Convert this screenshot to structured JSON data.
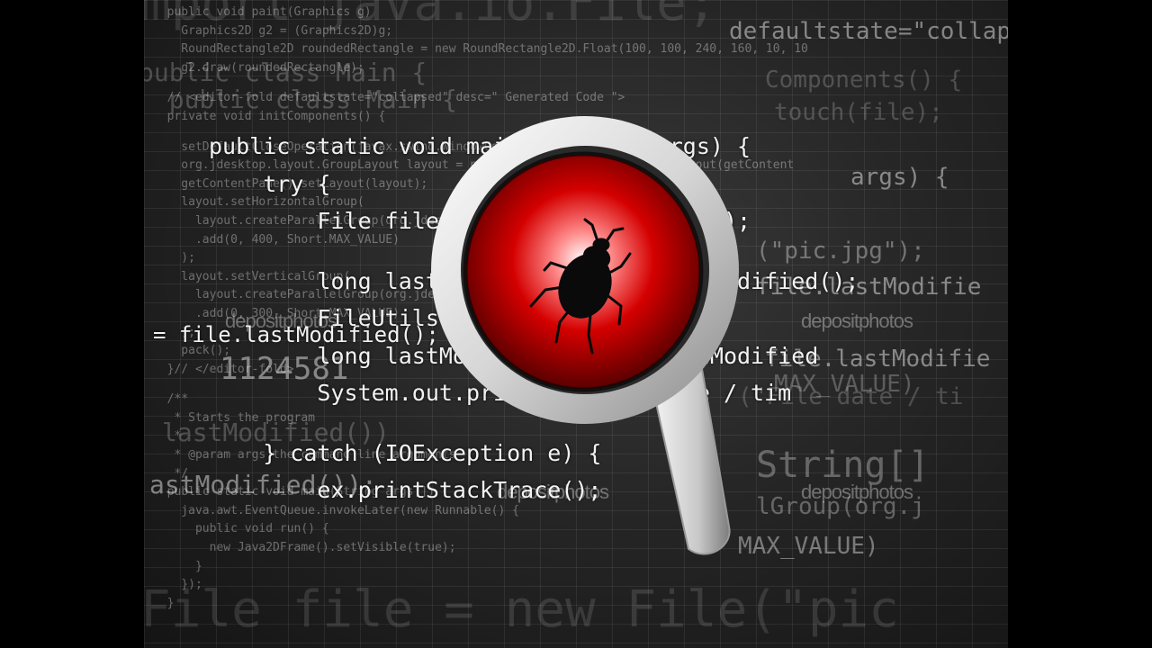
{
  "code_big": [
    "mport java.io.File;",
    "",
    "",
    "",
    "",
    "",
    "",
    "",
    "",
    "",
    "",
    "File file = new File(\"pic"
  ],
  "code_mid_left": [
    "public class Main {",
    "  public class Main {"
  ],
  "code_small_left": [
    "  public void paint(Graphics g)",
    "    Graphics2D g2 = (Graphics2D)g;",
    "    RoundRectangle2D roundedRectangle = new RoundRectangle2D.Float(100, 100, 240, 160, 10, 10",
    "    g2.draw(roundedRectangle);",
    "",
    "  // <editor-fold defaultstate=\"collapsed\" desc=\" Generated Code \">",
    "  private void initComponents() {",
    "",
    "    setDefaultCloseOperation(javax.swing.WindowConstants.EXIT_ON_CLOSE);",
    "    org.jdesktop.layout.GroupLayout layout = new org.jdesktop.layout.GroupLayout(getContent",
    "    getContentPane().setLayout(layout);",
    "    layout.setHorizontalGroup(",
    "      layout.createParallelGroup(org.jdesktop.layout.GroupLayout.LEADING)",
    "      .add(0, 400, Short.MAX_VALUE)",
    "    );",
    "    layout.setVerticalGroup(",
    "      layout.createParallelGroup(org.jdesktop.layout.GroupLayout.LEADING)",
    "      .add(0, 300, Short.MAX_VALUE)",
    "    );",
    "    pack();",
    "  }// </editor-fold>",
    "",
    "  /**",
    "   * Starts the program",
    "   *",
    "   * @param args the command line arguments",
    "   */",
    "  public static void main(String args[]) {",
    "    java.awt.EventQueue.invokeLater(new Runnable() {",
    "      public void run() {",
    "        new Java2DFrame().setVisible(true);",
    "      }",
    "    });",
    "  }"
  ],
  "code_fg": [
    "public static void main(String[] args) {",
    "    try {",
    "        File file = new File(\"pic.jpg\");",
    "",
    "        long lastModified = file.lastModified();",
    "        FileUtils.touch(file);",
    "        long lastModified = file.lastModified",
    "        System.out.println(\"File date / tim",
    "",
    "    } catch (IOException e) {",
    "        ex.printStackTrace();"
  ],
  "code_left_frag": [
    "= file.lastModified();",
    "lastModified())",
    "astModified());"
  ],
  "code_right_frag": [
    "defaultstate=\"collapsed\"",
    "Components() {",
    "touch(file);",
    "args) {",
    "(\"pic.jpg\");",
    "file.lastModifie",
    "file.lastModifie",
    "MAX_VALUE)",
    "(\"File date / ti",
    "String[]",
    "lGroup(org.j",
    "MAX_VALUE)"
  ],
  "number_text": "1124581",
  "watermark": "depositphotos",
  "colors": {
    "lens_red": "#d40000",
    "lens_ring": "#e6e6e6",
    "bug": "#0a0a0a"
  },
  "icons": [
    "magnifying-glass-icon",
    "bug-icon"
  ]
}
